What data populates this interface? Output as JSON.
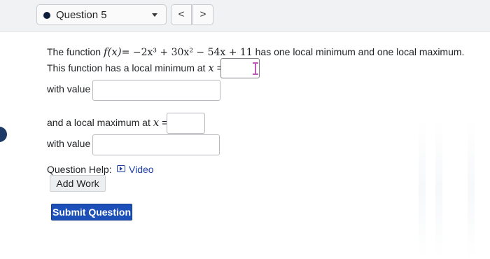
{
  "header": {
    "question_label": "Question 5",
    "prev_symbol": "<",
    "next_symbol": ">"
  },
  "problem": {
    "intro_prefix": "The function ",
    "function_lhs": "f(x)",
    "function_rhs": "= −2x³ + 30x² − 54x + 11",
    "intro_suffix": " has one local minimum and one local maximum.",
    "min_prompt": "This function has a local minimum at ",
    "var_x": "x",
    "equals": "=",
    "with_value_1": "with value",
    "max_prompt": "and a local maximum at ",
    "with_value_2": "with value"
  },
  "answers": {
    "min_x": "",
    "min_value": "",
    "max_x": "",
    "max_value": ""
  },
  "help": {
    "label": "Question Help:",
    "video_label": "Video",
    "add_work_label": "Add Work"
  },
  "submit_label": "Submit Question",
  "colors": {
    "accent": "#1d4fb8",
    "link": "#1a3fa6"
  }
}
